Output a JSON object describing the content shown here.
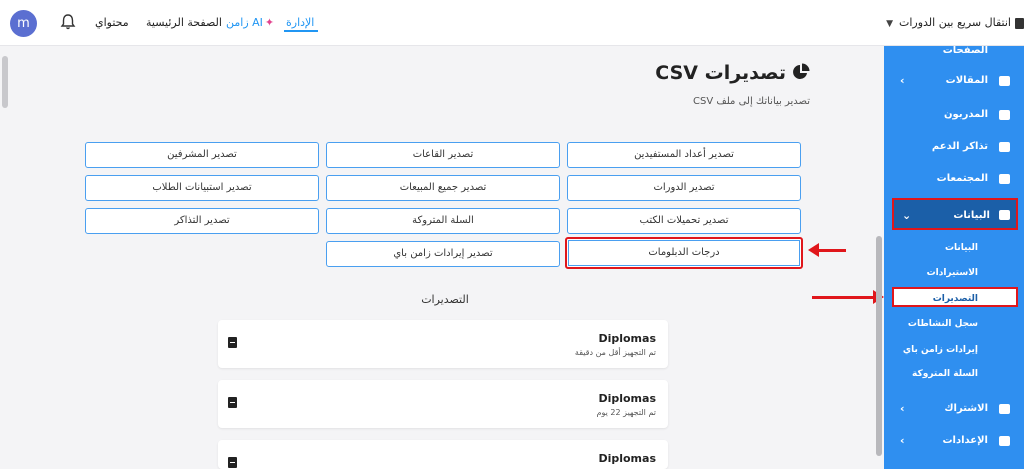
{
  "topbar": {
    "avatar_letter": "m",
    "nav": {
      "content": "محتواي",
      "home": "الصفحة الرئيسية",
      "ai": "زامن AI",
      "admin": "الإدارة"
    },
    "quick_switch": "انتقال سريع بين الدورات",
    "colors": {
      "accent": "#2196f3",
      "ai_spark": "#e2448f"
    }
  },
  "sidebar": {
    "partial_top": "الصفحات",
    "items": [
      {
        "label": "المقالات",
        "icon": "article-icon",
        "has_chevron": true
      },
      {
        "label": "المدربون",
        "icon": "trainer-icon"
      },
      {
        "label": "تذاكر الدعم",
        "icon": "support-icon"
      },
      {
        "label": "المجتمعات",
        "icon": "chat-icon"
      }
    ],
    "active": {
      "label": "البيانات",
      "icon": "data-icon"
    },
    "sub_items": [
      "البيانات",
      "الاستيرادات",
      "التصديرات",
      "سجل النشاطات",
      "إيرادات زامن باي",
      "السلة المتروكة"
    ],
    "active_sub": "التصديرات",
    "bottom_items": [
      {
        "label": "الاشتراك",
        "icon": "card-icon"
      },
      {
        "label": "الإعدادات",
        "icon": "gear-icon"
      }
    ],
    "colors": {
      "bg": "#2f8ff0",
      "active": "#1b5fa8",
      "highlight": "#e0161b"
    }
  },
  "main": {
    "title": "تصديرات CSV",
    "subtitle": "تصدير بياناتك إلى ملف CSV",
    "buttons": {
      "beneficiaries": "تصدير أعداد المستفيدين",
      "halls": "تصدير القاعات",
      "supervisors": "تصدير المشرفين",
      "courses": "تصدير الدورات",
      "sales": "تصدير جميع المبيعات",
      "survey": "تصدير استبيانات الطلاب",
      "book_downloads": "تصدير تحميلات الكتب",
      "abandoned_cart": "السلة المتروكة",
      "tickets": "تصدير التذاكر",
      "diplomas": "درجات الدبلومات",
      "zamn_pay": "تصدير إيرادات زامن باي"
    },
    "exports_title": "التصديرات",
    "exports": [
      {
        "name": "Diplomas",
        "time": "تم التجهيز أقل من دقيقة"
      },
      {
        "name": "Diplomas",
        "time": "تم التجهيز 22 يوم"
      },
      {
        "name": "Diplomas",
        "time": ""
      }
    ]
  }
}
